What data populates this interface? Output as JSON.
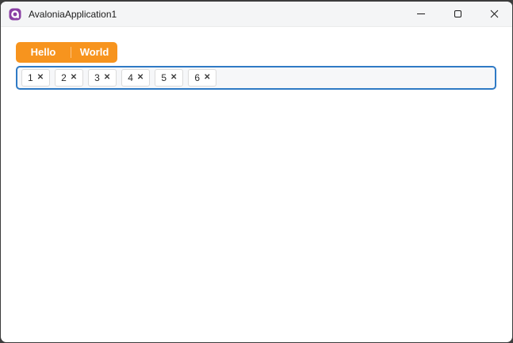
{
  "window": {
    "title": "AvaloniaApplication1",
    "icons": {
      "app": "avalonia-logo-icon",
      "minimize": "minimize-icon",
      "maximize": "maximize-icon",
      "close": "close-icon"
    }
  },
  "toolbar": {
    "tabs": [
      {
        "label": "Hello"
      },
      {
        "label": "World"
      }
    ]
  },
  "tag_box": {
    "tags": [
      {
        "label": "1"
      },
      {
        "label": "2"
      },
      {
        "label": "3"
      },
      {
        "label": "4"
      },
      {
        "label": "5"
      },
      {
        "label": "6"
      }
    ],
    "remove_glyph": "✕"
  },
  "colors": {
    "accent": "#F7941E",
    "focus": "#2F7AC5",
    "window-border": "#3C3C3C",
    "titlebar-bg": "#F4F5F6",
    "tagbox-bg": "#F6F7F9",
    "chip-border": "#DBDBDB",
    "text": "#1B1B1B"
  }
}
